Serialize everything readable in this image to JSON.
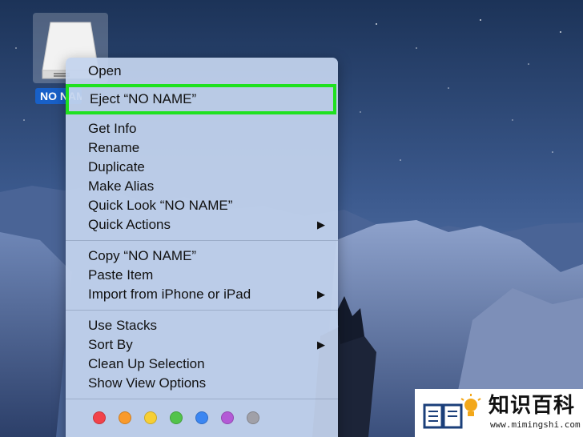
{
  "desktop": {
    "drive_label": "NO NAME",
    "drive_icon": "external-drive-icon"
  },
  "menu": {
    "items": [
      {
        "label": "Open"
      },
      {
        "label": "Eject “NO NAME”",
        "highlighted": true
      },
      {
        "label": "Get Info"
      },
      {
        "label": "Rename"
      },
      {
        "label": "Duplicate"
      },
      {
        "label": "Make Alias"
      },
      {
        "label": "Quick Look “NO NAME”"
      },
      {
        "label": "Quick Actions",
        "submenu": true
      },
      {
        "label": "Copy “NO NAME”"
      },
      {
        "label": "Paste Item"
      },
      {
        "label": "Import from iPhone or iPad",
        "submenu": true
      },
      {
        "label": "Use Stacks"
      },
      {
        "label": "Sort By",
        "submenu": true
      },
      {
        "label": "Clean Up Selection"
      },
      {
        "label": "Show View Options"
      }
    ],
    "submenu_arrow": "▶",
    "highlight_color": "#1fe11f",
    "tags": [
      {
        "name": "red-tag-icon",
        "color": "#f2424a"
      },
      {
        "name": "orange-tag-icon",
        "color": "#f99a2c"
      },
      {
        "name": "yellow-tag-icon",
        "color": "#f7cf34"
      },
      {
        "name": "green-tag-icon",
        "color": "#52c34a"
      },
      {
        "name": "blue-tag-icon",
        "color": "#3b86f2"
      },
      {
        "name": "purple-tag-icon",
        "color": "#b35ad6"
      },
      {
        "name": "gray-tag-icon",
        "color": "#a0a0a8"
      }
    ]
  },
  "watermark": {
    "title": "知识百科",
    "url": "www.mimingshi.com",
    "icon": "book-lightbulb-icon"
  }
}
